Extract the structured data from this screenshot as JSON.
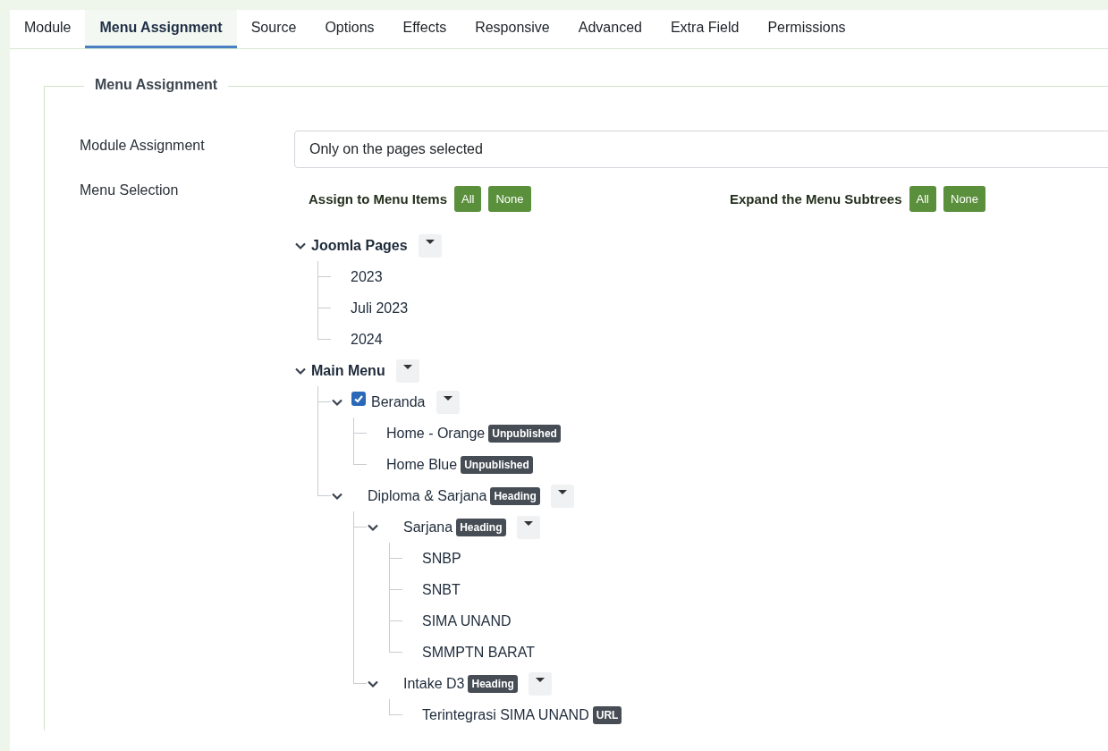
{
  "tabs": [
    {
      "label": "Module",
      "selected": false
    },
    {
      "label": "Menu Assignment",
      "selected": true
    },
    {
      "label": "Source",
      "selected": false
    },
    {
      "label": "Options",
      "selected": false
    },
    {
      "label": "Effects",
      "selected": false
    },
    {
      "label": "Responsive",
      "selected": false
    },
    {
      "label": "Advanced",
      "selected": false
    },
    {
      "label": "Extra Field",
      "selected": false
    },
    {
      "label": "Permissions",
      "selected": false
    }
  ],
  "fieldset": {
    "legend": "Menu Assignment",
    "module_assignment": {
      "label": "Module Assignment",
      "value": "Only on the pages selected"
    },
    "menu_selection": {
      "label": "Menu Selection",
      "assign": {
        "label": "Assign to Menu Items",
        "buttons": [
          "All",
          "None"
        ]
      },
      "expand": {
        "label": "Expand the Menu Subtrees",
        "buttons": [
          "All",
          "None"
        ]
      },
      "menus": [
        {
          "label": "Joomla Pages",
          "expanded": true,
          "children": [
            {
              "label": "2023",
              "checked": false
            },
            {
              "label": "Juli 2023",
              "checked": false
            },
            {
              "label": "2024",
              "checked": false
            }
          ]
        },
        {
          "label": "Main Menu",
          "expanded": true,
          "children": [
            {
              "label": "Beranda",
              "checked": true,
              "expanded": true,
              "children": [
                {
                  "label": "Home - Orange",
                  "badge": "Unpublished",
                  "checked": false
                },
                {
                  "label": "Home Blue",
                  "badge": "Unpublished",
                  "checked": false
                }
              ]
            },
            {
              "label": "Diploma & Sarjana",
              "badge": "Heading",
              "checked": false,
              "expanded": true,
              "children": [
                {
                  "label": "Sarjana",
                  "badge": "Heading",
                  "checked": false,
                  "expanded": true,
                  "children": [
                    {
                      "label": "SNBP",
                      "checked": false
                    },
                    {
                      "label": "SNBT",
                      "checked": false
                    },
                    {
                      "label": "SIMA UNAND",
                      "checked": false
                    },
                    {
                      "label": "SMMPTN BARAT",
                      "checked": false
                    }
                  ]
                },
                {
                  "label": "Intake D3",
                  "badge": "Heading",
                  "checked": false,
                  "expanded": true,
                  "children": [
                    {
                      "label": "Terintegrasi SIMA UNAND",
                      "badge": "URL",
                      "checked": false
                    }
                  ]
                }
              ]
            }
          ]
        }
      ]
    }
  }
}
